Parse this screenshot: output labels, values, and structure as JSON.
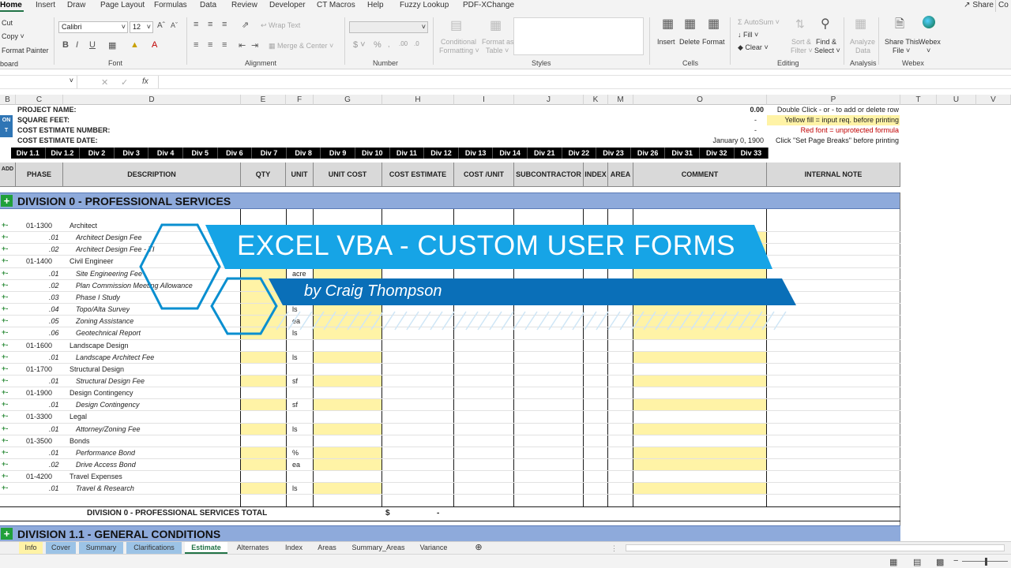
{
  "menu": {
    "tabs": [
      "Home",
      "Insert",
      "Draw",
      "Page Layout",
      "Formulas",
      "Data",
      "Review",
      "Developer",
      "CT Macros",
      "Help",
      "Fuzzy Lookup",
      "PDF-XChange"
    ],
    "share": "Share",
    "co": "Co"
  },
  "ribbon": {
    "clipboard": {
      "cut": "Cut",
      "copy": "Copy",
      "format_painter": "Format Painter",
      "label": "board"
    },
    "font": {
      "name": "Calibri",
      "size": "12",
      "label": "Font"
    },
    "alignment": {
      "wrap": "Wrap Text",
      "merge": "Merge & Center",
      "label": "Alignment"
    },
    "number": {
      "label": "Number"
    },
    "styles": {
      "cond": "Conditional",
      "cond2": "Formatting",
      "fmt": "Format as",
      "fmt2": "Table",
      "label": "Styles"
    },
    "cells": {
      "insert": "Insert",
      "delete": "Delete",
      "format": "Format",
      "label": "Cells"
    },
    "editing": {
      "autosum": "AutoSum",
      "fill": "Fill",
      "clear": "Clear",
      "sort": "Sort &",
      "sort2": "Filter",
      "find": "Find &",
      "find2": "Select",
      "label": "Editing"
    },
    "analysis": {
      "a1": "Analyze",
      "a2": "Data",
      "label": "Analysis"
    },
    "webex": {
      "share1": "Share This",
      "share2": "File",
      "webex": "Webex",
      "label": "Webex"
    }
  },
  "formula_bar": {
    "fx": "fx"
  },
  "columns": [
    "B",
    "C",
    "D",
    "E",
    "F",
    "G",
    "H",
    "I",
    "J",
    "K",
    "M",
    "O",
    "P",
    "T",
    "U",
    "V"
  ],
  "header_block": {
    "project_name": "PROJECT NAME:",
    "square_feet": "SQUARE FEET:",
    "estimate_number": "COST ESTIMATE NUMBER:",
    "estimate_date": "COST ESTIMATE DATE:",
    "pn_value": "0.00",
    "sf_value": "-",
    "en_value": "-",
    "date_value": "January 0, 1900",
    "side_1": "ON",
    "side_2": "T",
    "note1": "Double Click - or - to add or delete row",
    "note2": "Yellow fill = input req. before printing",
    "note3": "Red font = unprotected formula",
    "note4": "Click \"Set Page Breaks\" before printing"
  },
  "divisions": [
    "Div 1.1",
    "Div 1.2",
    "Div 2",
    "Div 3",
    "Div 4",
    "Div 5",
    "Div 6",
    "Div 7",
    "Div 8",
    "Div 9",
    "Div 10",
    "Div 11",
    "Div 12",
    "Div 13",
    "Div 14",
    "Div 21",
    "Div 22",
    "Div 23",
    "Div 26",
    "Div 31",
    "Div 32",
    "Div 33"
  ],
  "table_headers": {
    "add": "ADD",
    "phase_code": "PHASE CODE",
    "description": "DESCRIPTION",
    "qty": "QTY",
    "unit": "UNIT",
    "unit_cost": "UNIT COST",
    "cost_estimate": "COST ESTIMATE",
    "cost_unit": "COST /UNIT",
    "subcontractor": "SUBCONTRACTOR",
    "index": "INDEX",
    "area": "AREA",
    "comment": "COMMENT",
    "internal_note": "INTERNAL NOTE"
  },
  "section0": {
    "title": "DIVISION 0 - PROFESSIONAL SERVICES",
    "total_label": "DIVISION 0 - PROFESSIONAL SERVICES TOTAL",
    "total_currency": "$",
    "total_value": "-"
  },
  "section1": {
    "title": "DIVISION 1.1 - GENERAL CONDITIONS"
  },
  "rows": [
    {
      "code": "01-1300",
      "desc": "Architect",
      "unit": "",
      "sub": false
    },
    {
      "code": ".01",
      "desc": "Architect Design Fee",
      "unit": "",
      "sub": true
    },
    {
      "code": ".02",
      "desc": "Architect Design Fee - TI",
      "unit": "",
      "sub": true
    },
    {
      "code": "01-1400",
      "desc": "Civil Engineer",
      "unit": "",
      "sub": false
    },
    {
      "code": ".01",
      "desc": "Site Engineering Fee",
      "unit": "acre",
      "sub": true
    },
    {
      "code": ".02",
      "desc": "Plan Commission Meeting Allowance",
      "unit": "",
      "sub": true
    },
    {
      "code": ".03",
      "desc": "Phase I Study",
      "unit": "",
      "sub": true
    },
    {
      "code": ".04",
      "desc": "Topo/Alta Survey",
      "unit": "ls",
      "sub": true
    },
    {
      "code": ".05",
      "desc": "Zoning Assistance",
      "unit": "ea",
      "sub": true
    },
    {
      "code": ".06",
      "desc": "Geotechnical Report",
      "unit": "ls",
      "sub": true
    },
    {
      "code": "01-1600",
      "desc": "Landscape Design",
      "unit": "",
      "sub": false
    },
    {
      "code": ".01",
      "desc": "Landscape Architect Fee",
      "unit": "ls",
      "sub": true
    },
    {
      "code": "01-1700",
      "desc": "Structural Design",
      "unit": "",
      "sub": false
    },
    {
      "code": ".01",
      "desc": "Structural Design Fee",
      "unit": "sf",
      "sub": true
    },
    {
      "code": "01-1900",
      "desc": "Design Contingency",
      "unit": "",
      "sub": false
    },
    {
      "code": ".01",
      "desc": "Design Contingency",
      "unit": "sf",
      "sub": true
    },
    {
      "code": "01-3300",
      "desc": "Legal",
      "unit": "",
      "sub": false
    },
    {
      "code": ".01",
      "desc": "Attorney/Zoning Fee",
      "unit": "ls",
      "sub": true
    },
    {
      "code": "01-3500",
      "desc": "Bonds",
      "unit": "",
      "sub": false
    },
    {
      "code": ".01",
      "desc": "Performance Bond",
      "unit": "%",
      "sub": true
    },
    {
      "code": ".02",
      "desc": "Drive Access Bond",
      "unit": "ea",
      "sub": true
    },
    {
      "code": "01-4200",
      "desc": "Travel Expenses",
      "unit": "",
      "sub": false
    },
    {
      "code": ".01",
      "desc": "Travel & Research",
      "unit": "ls",
      "sub": true
    }
  ],
  "overlay": {
    "title": "EXCEL VBA - CUSTOM USER FORMS",
    "subtitle": "by Craig Thompson"
  },
  "sheets": [
    "Info",
    "Cover",
    "Summary",
    "Clarifications",
    "Estimate",
    "Alternates",
    "Index",
    "Areas",
    "Summary_Areas",
    "Variance"
  ],
  "active_sheet": "Estimate"
}
